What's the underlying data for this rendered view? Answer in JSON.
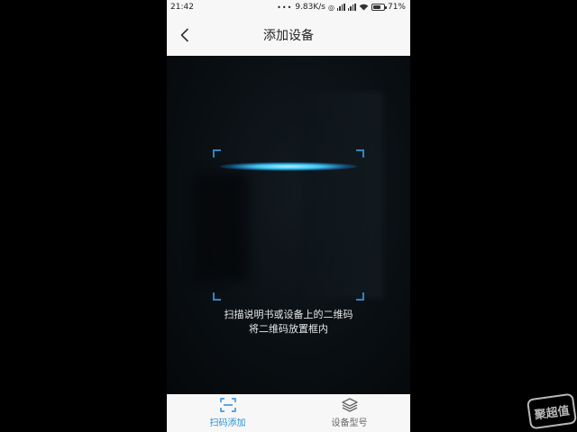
{
  "status_bar": {
    "time": "21:42",
    "net_speed": "9.83K/s",
    "battery": "71%",
    "battery_level": 0.71
  },
  "nav": {
    "title": "添加设备",
    "back_icon": "chevron-left-icon"
  },
  "scanner": {
    "hint_line1": "扫描说明书或设备上的二维码",
    "hint_line2": "将二维码放置框内",
    "frame_color": "#2f86c4",
    "scan_line_color": "#3cc2f0"
  },
  "tabs": [
    {
      "label": "扫码添加",
      "icon": "scan-icon",
      "active": true
    },
    {
      "label": "设备型号",
      "icon": "layers-icon",
      "active": false
    }
  ],
  "colors": {
    "accent": "#2c8fd6",
    "bar_background": "#f7f7f7"
  },
  "watermark": "聚超值"
}
